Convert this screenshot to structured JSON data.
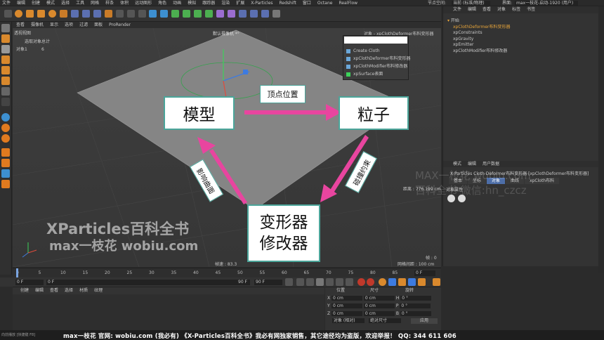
{
  "menubar": {
    "items": [
      "文件",
      "编辑",
      "创建",
      "模式",
      "选择",
      "工具",
      "网格",
      "样条",
      "体积",
      "运动图形",
      "角色",
      "动画",
      "模拟",
      "跟踪器",
      "渲染",
      "扩展",
      "X-Particles",
      "Redshift",
      "窗口",
      "Octane",
      "RealFlow"
    ],
    "node_space_label": "节点空间:",
    "node_space_value": "当前 (标准/物理)",
    "interface_label": "界面:",
    "interface_value": "max一枝花-启动-1920 (用户)"
  },
  "viewport": {
    "menu": [
      "查看",
      "摄像机",
      "显示",
      "选项",
      "过滤",
      "面板",
      "ProRender"
    ],
    "title": "透视视图",
    "camera": "默认摄像机 *°",
    "hud_col1": "选取对象",
    "hud_col2": "总计",
    "hud_row_label": "对象",
    "hud_val1": "1",
    "hud_val2": "6",
    "obj_label": "对象 - xpClothDeformer布料变形器",
    "distance": "距离 : 776.199 cm",
    "frame": "帧 : 0",
    "fps": "帧速 : 83.3",
    "grid": "网格间距 : 100 cm"
  },
  "diagram": {
    "model": "模型",
    "particle": "粒子",
    "deformer_line1": "变形器",
    "deformer_line2": "修改器",
    "arrow_top": "顶点位置",
    "arrow_right": "碰撞约束",
    "arrow_left": "影响曲面"
  },
  "watermark": {
    "line1": "XParticles百科全书",
    "line2": "max一枝花 wobiu.com",
    "right1": "MAX一枝花 wobiu.com",
    "right2": "百科全书 微信:hn_czcz"
  },
  "popup": {
    "items": [
      "Create Cloth",
      "xpClothDeformer布料变形器",
      "xpClothModifier布料修改器",
      "xpSurface表面"
    ]
  },
  "objects": {
    "menu": [
      "文件",
      "编辑",
      "查看",
      "对象",
      "标签",
      "书签"
    ],
    "rows": [
      "开始",
      "xpClothDeformer布料变形器",
      "xpConstraints",
      "xpGravity",
      "xpEmitter",
      "xpClothModifier布料修改器"
    ]
  },
  "attributes": {
    "menu": [
      "模式",
      "编辑",
      "用户数据"
    ],
    "title": "X-Particles Cloth Deformer布料变形器 [xpClothDeformer布料变形器]",
    "tabs": [
      "基本",
      "坐标",
      "对象",
      "曲线",
      "xpCloth布料"
    ],
    "section": "对象属性"
  },
  "timeline": {
    "ticks": [
      "0",
      "5",
      "10",
      "15",
      "20",
      "25",
      "30",
      "35",
      "40",
      "45",
      "50",
      "55",
      "60",
      "65",
      "70",
      "75",
      "80",
      "85",
      "90"
    ],
    "start_field": "0 F",
    "start_field2": "0 F",
    "end_field": "90 F",
    "end_field2": "90 F",
    "current_frame": "0 F"
  },
  "materials": {
    "menu": [
      "创建",
      "编辑",
      "查看",
      "选择",
      "材质",
      "纹理"
    ]
  },
  "coords": {
    "headers": [
      "位置",
      "尺寸",
      "旋转"
    ],
    "rows": [
      {
        "axis": "X",
        "pos": "0 cm",
        "size": "0 cm",
        "rot_label": "H",
        "rot": "0 °"
      },
      {
        "axis": "Y",
        "pos": "0 cm",
        "size": "0 cm",
        "rot_label": "P",
        "rot": "0 °"
      },
      {
        "axis": "Z",
        "pos": "0 cm",
        "size": "0 cm",
        "rot_label": "B",
        "rot": "0 °"
      }
    ],
    "mode1": "对象 (相对)",
    "mode2": "绝对尺寸",
    "apply": "应用"
  },
  "status": {
    "left": "向前播放 [快捷键 F8]",
    "banner": "max一枝花 官网: wobiu.com (我必有) 《X-Particles百科全书》我必有网独家销售，其它途径均为盗版，欢迎举报！ QQ: 344 611 606"
  },
  "colors": {
    "accent": "#4ba59a",
    "arrow": "#e8459f",
    "highlight": "#e8a53a"
  }
}
